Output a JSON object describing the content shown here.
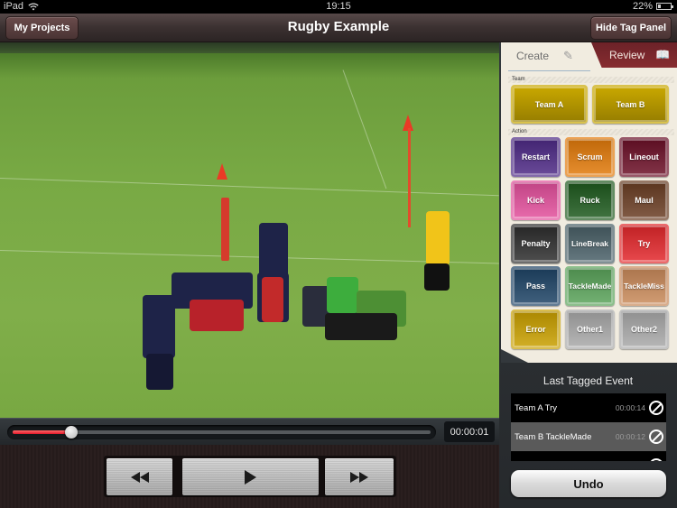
{
  "status_bar": {
    "device": "iPad",
    "time": "19:15",
    "battery": "22%",
    "battery_level": 0.22
  },
  "nav": {
    "title": "Rugby Example",
    "left_button": "My Projects",
    "right_button": "Hide Tag Panel"
  },
  "player": {
    "timecode": "00:00:01",
    "progress": 0.14,
    "controls": [
      {
        "name": "rewind",
        "icon": "rewind-icon"
      },
      {
        "name": "play",
        "icon": "play-icon"
      },
      {
        "name": "fast-forward",
        "icon": "fast-forward-icon"
      }
    ]
  },
  "tag_panel": {
    "tabs": [
      {
        "label": "Create",
        "icon": "edit-icon",
        "active": true
      },
      {
        "label": "Review",
        "icon": "book-icon",
        "active": false
      }
    ],
    "team_section_label": "Team",
    "action_section_label": "Action",
    "teams": [
      {
        "label": "Team A",
        "color": "#c9a800"
      },
      {
        "label": "Team B",
        "color": "#c9a800"
      }
    ],
    "actions": [
      {
        "label": "Restart",
        "color": "#4e2a86"
      },
      {
        "label": "Scrum",
        "color": "#e27a0a"
      },
      {
        "label": "Lineout",
        "color": "#6c1028"
      },
      {
        "label": "Kick",
        "color": "#e3509c"
      },
      {
        "label": "Ruck",
        "color": "#1e5a1e"
      },
      {
        "label": "Maul",
        "color": "#6b3e24"
      },
      {
        "label": "Penalty",
        "color": "#2e2e2e"
      },
      {
        "label": "LineBreak",
        "color": "#4a6068"
      },
      {
        "label": "Try",
        "color": "#e3282c"
      },
      {
        "label": "Pass",
        "color": "#1e4466"
      },
      {
        "label": "TackleMade",
        "color": "#5aa35a"
      },
      {
        "label": "TackleMiss",
        "color": "#c98a5a"
      },
      {
        "label": "Error",
        "color": "#c9a000"
      },
      {
        "label": "Other1",
        "color": "#a9a9a9"
      },
      {
        "label": "Other2",
        "color": "#a9a9a9"
      }
    ],
    "last_tagged": {
      "title": "Last Tagged Event",
      "events": [
        {
          "label": "Team A Try",
          "time": "00:00:14"
        },
        {
          "label": "Team B TackleMade",
          "time": "00:00:12"
        },
        {
          "label": "",
          "time": ""
        }
      ]
    },
    "undo_label": "Undo"
  }
}
